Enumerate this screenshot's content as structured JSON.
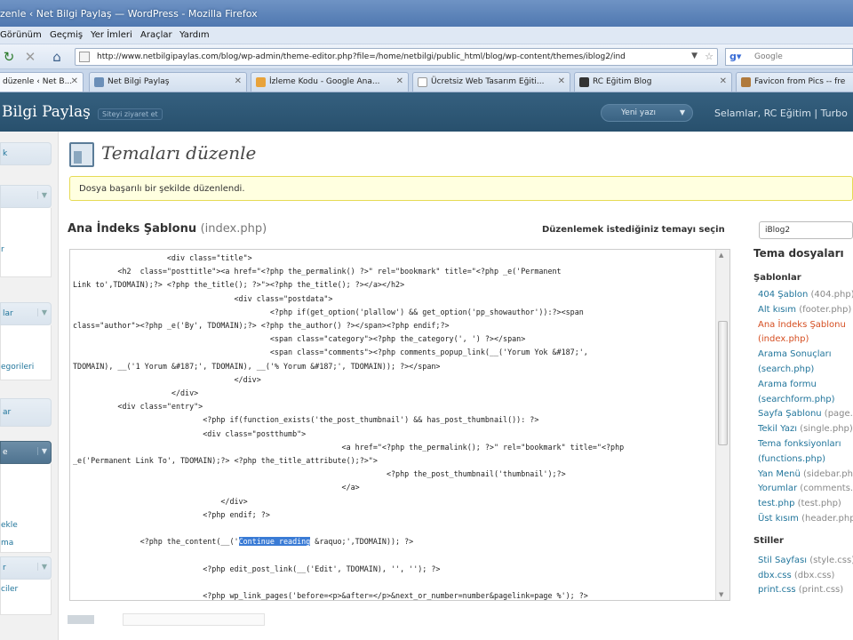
{
  "browser": {
    "title": "zenle ‹ Net Bilgi Paylaş — WordPress - Mozilla Firefox",
    "menu": [
      "Görünüm",
      "Geçmiş",
      "Yer İmleri",
      "Araçlar",
      "Yardım"
    ],
    "url": "http://www.netbilgipaylas.com/blog/wp-admin/theme-editor.php?file=/home/netbilgi/public_html/blog/wp-content/themes/iblog2/ind",
    "search_placeholder": "Google",
    "tabs": [
      {
        "label": "düzenle ‹ Net B...",
        "active": true
      },
      {
        "label": "Net Bilgi Paylaş",
        "active": false
      },
      {
        "label": "İzleme Kodu - Google Ana...",
        "active": false
      },
      {
        "label": "Ücretsiz Web Tasarım Eğiti...",
        "active": false
      },
      {
        "label": "RC Eğitim Blog",
        "active": false
      },
      {
        "label": "Favicon from Pics -- fre",
        "active": false
      }
    ]
  },
  "wp_header": {
    "site_name": "Bilgi Paylaş",
    "visit_site": "Siteyi ziyaret et",
    "new_post": "Yeni yazı",
    "greeting": "Selamlar, RC Eğitim | Turbo"
  },
  "sidebar": {
    "items": [
      "k",
      "r",
      "lar",
      "egorileri",
      "ar",
      "e",
      "ekle",
      "ma",
      "r",
      "ciler"
    ]
  },
  "main": {
    "page_title": "Temaları düzenle",
    "notice": "Dosya başarılı bir şekilde düzenlendi.",
    "file_title": "Ana İndeks Şablonu",
    "file_name": "(index.php)",
    "select_label": "Düzenlemek istediğiniz temayı seçin",
    "selected_theme": "iBlog2"
  },
  "editor": {
    "lines": [
      "                     <div class=\"title\">",
      "          <h2  class=\"posttitle\"><a href=\"<?php the_permalink() ?>\" rel=\"bookmark\" title=\"<?php _e('Permanent",
      "Link to',TDOMAIN);?> <?php the_title(); ?>\"><?php the_title(); ?></a></h2>",
      "                                    <div class=\"postdata\">",
      "                                            <?php if(get_option('plallow') && get_option('pp_showauthor')):?><span",
      "class=\"author\"><?php _e('By', TDOMAIN);?> <?php the_author() ?></span><?php endif;?>",
      "                                            <span class=\"category\"><?php the_category(', ') ?></span>",
      "                                            <span class=\"comments\"><?php comments_popup_link(__('Yorum Yok &#187;',",
      "TDOMAIN), __('1 Yorum &#187;', TDOMAIN), __('% Yorum &#187;', TDOMAIN)); ?></span>",
      "                                    </div>",
      "                      </div>",
      "          <div class=\"entry\">",
      "                             <?php if(function_exists('the_post_thumbnail') && has_post_thumbnail()): ?>",
      "                             <div class=\"postthumb\">",
      "                                                            <a href=\"<?php the_permalink(); ?>\" rel=\"bookmark\" title=\"<?php",
      "_e('Permanent Link To', TDOMAIN);?> <?php the_title_attribute();?>\">",
      "                                                                      <?php the_post_thumbnail('thumbnail');?>",
      "                                                            </a>",
      "                                 </div>",
      "                             <?php endif; ?>",
      "",
      "               <?php the_content(__('",
      "",
      "                             <?php edit_post_link(__('Edit', TDOMAIN), '', ''); ?>",
      "",
      "                             <?php wp_link_pages('before=<p>&after=</p>&next_or_number=number&pagelink=page %'); ?>"
    ],
    "content_prefix": "               <?php the_content(__('",
    "content_selected": "Continue reading",
    "content_suffix": " &raquo;',TDOMAIN)); ?>"
  },
  "rightcol": {
    "title": "Tema dosyaları",
    "templates_heading": "Şablonlar",
    "templates": [
      {
        "name": "404 Şablon",
        "file": "(404.php)"
      },
      {
        "name": "Alt kısım",
        "file": "(footer.php)"
      },
      {
        "name": "Ana İndeks Şablonu",
        "file": ""
      },
      {
        "name": "(index.php)",
        "file": ""
      },
      {
        "name": "Arama Sonuçları",
        "file": ""
      },
      {
        "name": "(search.php)",
        "file": ""
      },
      {
        "name": "Arama formu",
        "file": ""
      },
      {
        "name": "(searchform.php)",
        "file": ""
      },
      {
        "name": "Sayfa Şablonu",
        "file": "(page.php)"
      },
      {
        "name": "Tekil Yazı",
        "file": "(single.php)"
      },
      {
        "name": "Tema fonksiyonları",
        "file": ""
      },
      {
        "name": "(functions.php)",
        "file": ""
      },
      {
        "name": "Yan Menü",
        "file": "(sidebar.php)"
      },
      {
        "name": "Yorumlar",
        "file": "(comments.php)"
      },
      {
        "name": "test.php",
        "file": "(test.php)"
      },
      {
        "name": "Üst kısım",
        "file": "(header.php)"
      }
    ],
    "styles_heading": "Stiller",
    "styles": [
      {
        "name": "Stil Sayfası",
        "file": "(style.css)"
      },
      {
        "name": "dbx.css",
        "file": "(dbx.css)"
      },
      {
        "name": "print.css",
        "file": "(print.css)"
      }
    ]
  }
}
